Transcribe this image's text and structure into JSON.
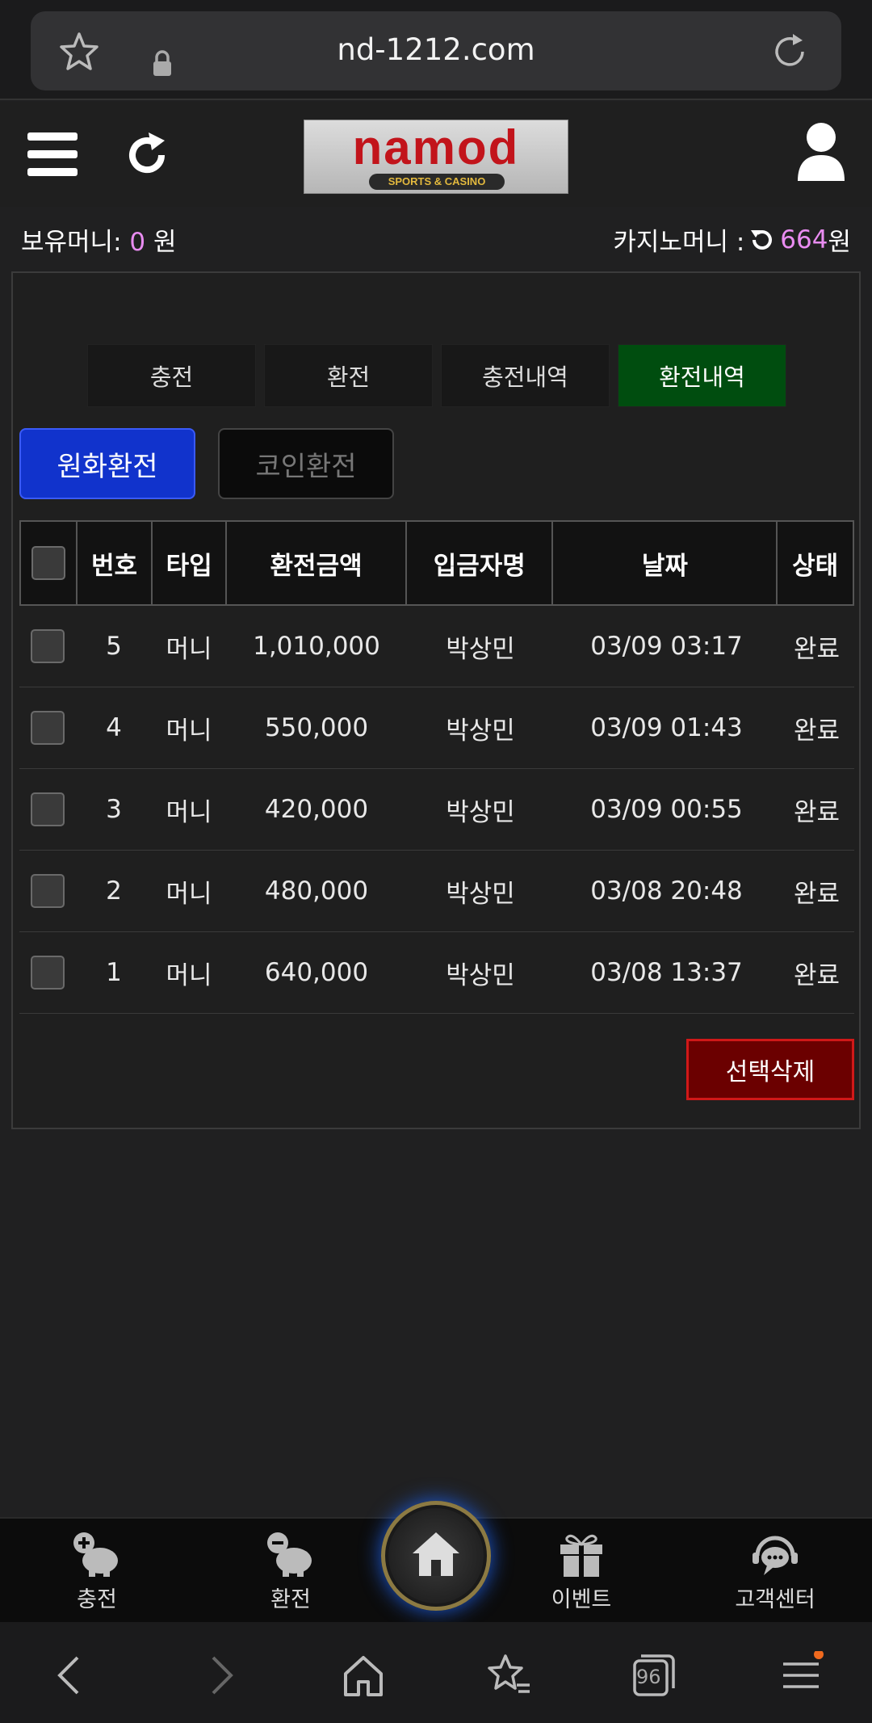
{
  "browser": {
    "url": "nd-1212.com",
    "tab_count": "96"
  },
  "header": {
    "logo_text": "namod",
    "logo_sub": "SPORTS & CASINO"
  },
  "balance": {
    "money_label": "보유머니: ",
    "money_value": "0",
    "money_unit": " 원",
    "casino_label": "카지노머니 : ",
    "casino_value": "664",
    "casino_unit": " 원"
  },
  "tabs": [
    "충전",
    "환전",
    "충전내역",
    "환전내역"
  ],
  "active_tab": "환전내역",
  "subtabs": {
    "primary": "원화환전",
    "secondary": "코인환전"
  },
  "table": {
    "headers": [
      "번호",
      "타입",
      "환전금액",
      "입금자명",
      "날짜",
      "상태"
    ],
    "rows": [
      {
        "no": "5",
        "type": "머니",
        "amount": "1,010,000",
        "name": "박상민",
        "date": "03/09 03:17",
        "status": "완료"
      },
      {
        "no": "4",
        "type": "머니",
        "amount": "550,000",
        "name": "박상민",
        "date": "03/09 01:43",
        "status": "완료"
      },
      {
        "no": "3",
        "type": "머니",
        "amount": "420,000",
        "name": "박상민",
        "date": "03/09 00:55",
        "status": "완료"
      },
      {
        "no": "2",
        "type": "머니",
        "amount": "480,000",
        "name": "박상민",
        "date": "03/08 20:48",
        "status": "완료"
      },
      {
        "no": "1",
        "type": "머니",
        "amount": "640,000",
        "name": "박상민",
        "date": "03/08 13:37",
        "status": "완료"
      }
    ]
  },
  "delete_button": "선택삭제",
  "bottom_nav": {
    "charge": "충전",
    "exchange": "환전",
    "event": "이벤트",
    "support": "고객센터"
  },
  "colors": {
    "active_tab": "#004d0f",
    "primary_button": "#1133cc",
    "delete_button": "#6b0000",
    "highlight_value": "#e98cf1"
  }
}
